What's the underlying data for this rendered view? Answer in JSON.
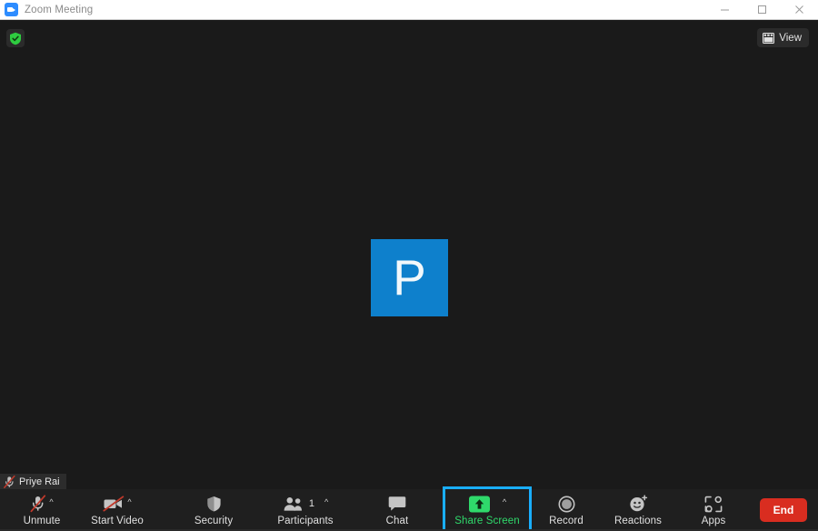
{
  "window": {
    "title": "Zoom Meeting",
    "logo_icon": "zoom-camera-icon",
    "controls": [
      {
        "name": "minimize",
        "icon": "minimize-icon"
      },
      {
        "name": "maximize",
        "icon": "maximize-icon"
      },
      {
        "name": "close",
        "icon": "close-icon"
      }
    ]
  },
  "stage": {
    "encryption": {
      "icon": "shield-check-icon",
      "color": "#2ecc40"
    },
    "view": {
      "label": "View",
      "icon": "layout-grid-icon"
    },
    "participant_tile": {
      "initial": "P",
      "avatar_color": "#0e80cc",
      "text_color": "#f2f8fb"
    },
    "self_name_chip": {
      "name": "Priye Rai",
      "icon": "mic-muted-icon",
      "icon_color": "#c0392b"
    },
    "background_color": "#1a1a1a"
  },
  "toolbar": {
    "background_color": "#1f1f1f",
    "items": [
      {
        "id": "unmute",
        "label": "Unmute",
        "icon": "mic-muted-icon",
        "caret": "^",
        "has_caret": true,
        "active": false
      },
      {
        "id": "start-video",
        "label": "Start Video",
        "icon": "video-muted-icon",
        "caret": "^",
        "has_caret": true,
        "active": false
      },
      {
        "id": "security",
        "label": "Security",
        "icon": "shield-icon",
        "caret": "",
        "has_caret": false,
        "active": false
      },
      {
        "id": "participants",
        "label": "Participants",
        "icon": "people-icon",
        "caret": "^",
        "has_caret": true,
        "active": false,
        "count": "1"
      },
      {
        "id": "chat",
        "label": "Chat",
        "icon": "chat-bubble-icon",
        "caret": "",
        "has_caret": false,
        "active": false
      },
      {
        "id": "share-screen",
        "label": "Share Screen",
        "icon": "share-arrow-up-icon",
        "caret": "^",
        "has_caret": true,
        "active": true
      },
      {
        "id": "record",
        "label": "Record",
        "icon": "record-circle-icon",
        "caret": "",
        "has_caret": false,
        "active": false
      },
      {
        "id": "reactions",
        "label": "Reactions",
        "icon": "smiley-plus-icon",
        "caret": "",
        "has_caret": false,
        "active": false
      },
      {
        "id": "apps",
        "label": "Apps",
        "icon": "apps-bracket-icon",
        "caret": "",
        "has_caret": false,
        "active": false
      }
    ],
    "end_button": {
      "label": "End",
      "color": "#d92d20",
      "text_color": "#ffffff"
    },
    "highlight_color": "#19aeff",
    "share_active_color": "#2fd96b"
  }
}
